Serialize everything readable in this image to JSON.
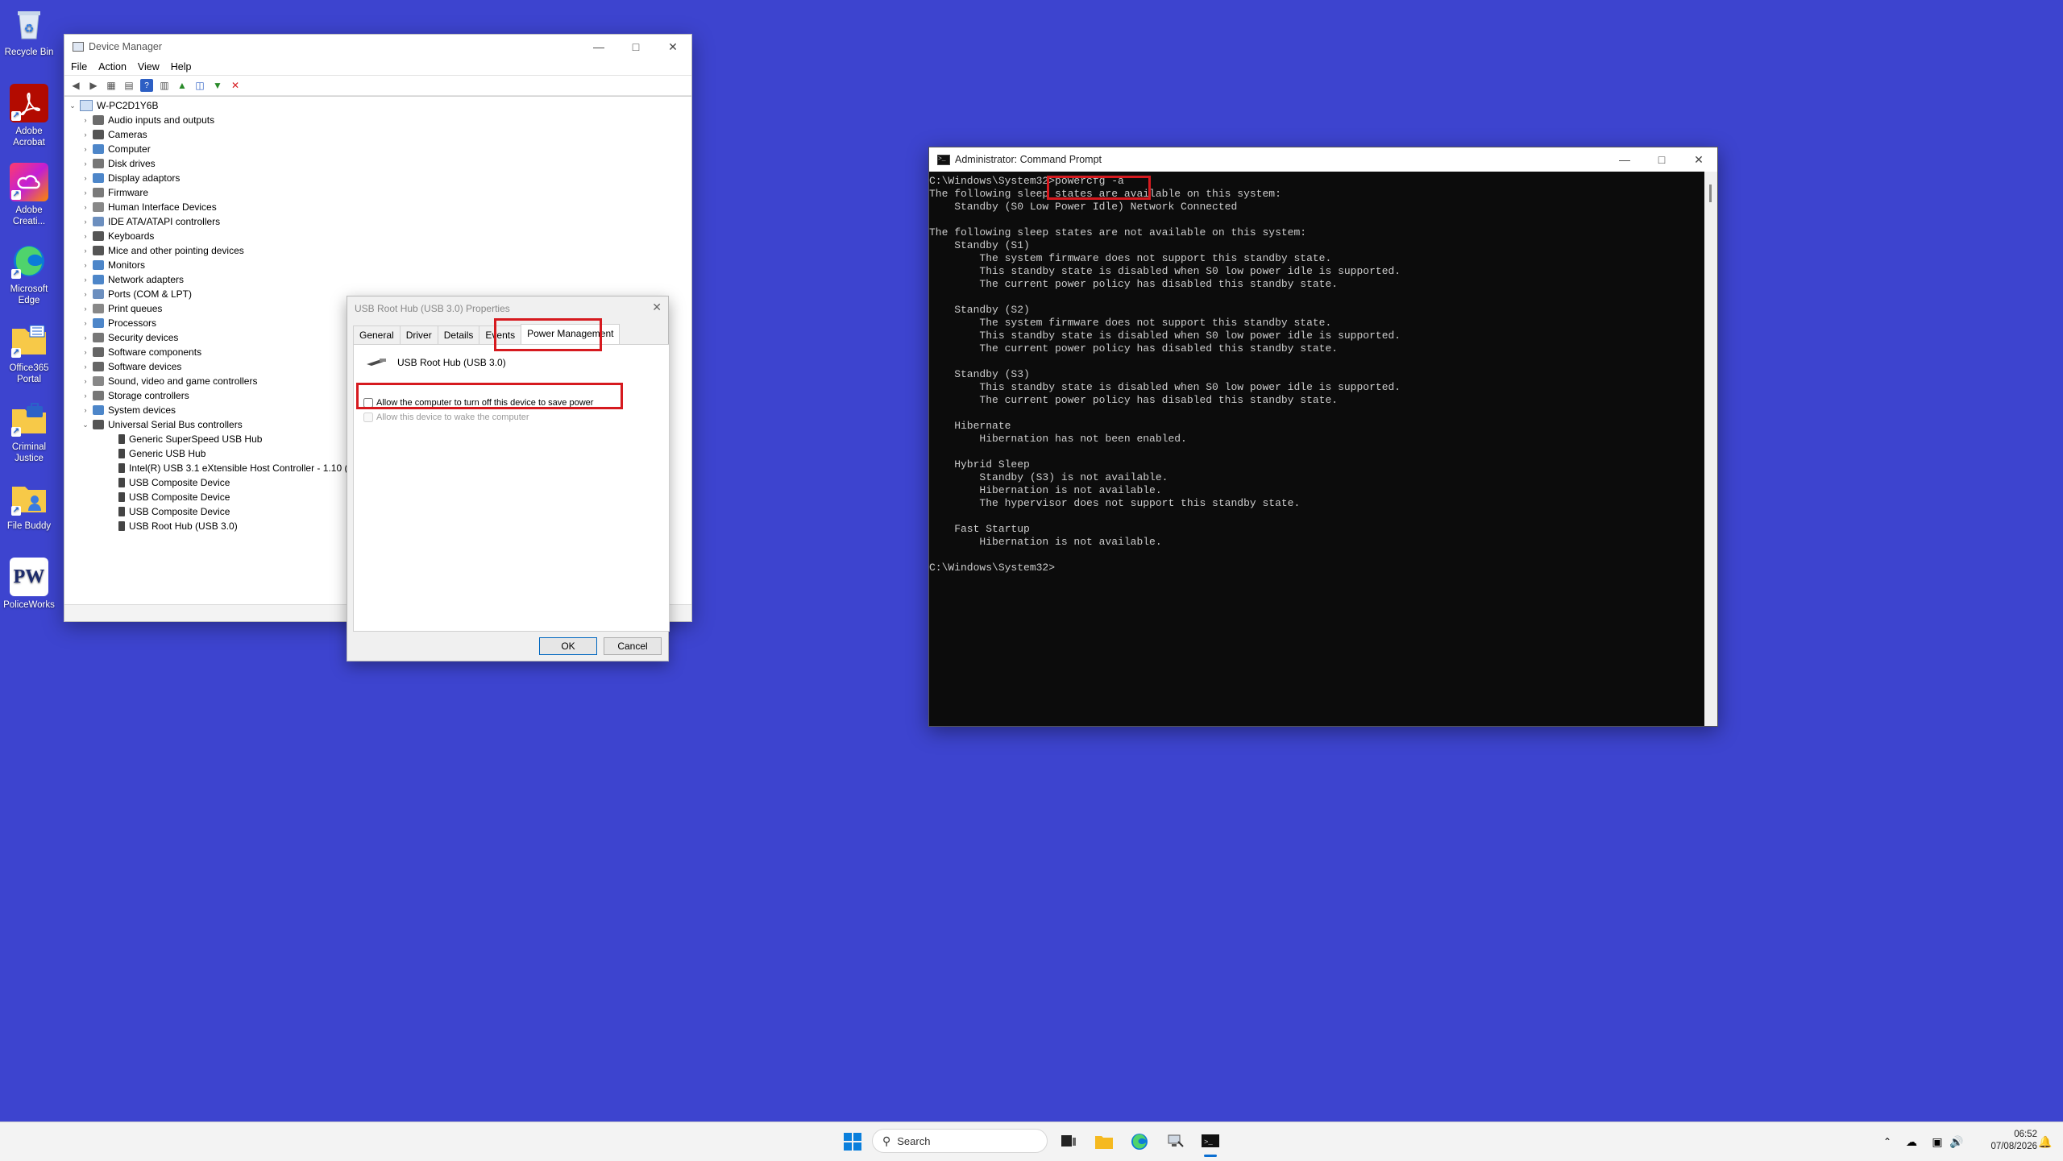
{
  "desktop": {
    "icons": [
      {
        "label_1": "Recycle Bin",
        "label_2": "",
        "icon": "recycle-bin-icon"
      },
      {
        "label_1": "Adobe",
        "label_2": "Acrobat",
        "icon": "adobe-acrobat-icon"
      },
      {
        "label_1": "Adobe",
        "label_2": "Creati...",
        "icon": "adobe-creative-cloud-icon"
      },
      {
        "label_1": "Microsoft",
        "label_2": "Edge",
        "icon": "edge-icon"
      },
      {
        "label_1": "Office365",
        "label_2": "Portal",
        "icon": "folder-icon"
      },
      {
        "label_1": "Criminal",
        "label_2": "Justice",
        "icon": "briefcase-icon"
      },
      {
        "label_1": "File Buddy",
        "label_2": "",
        "icon": "folder-people-icon"
      },
      {
        "label_1": "PoliceWorks",
        "label_2": "",
        "icon": "policeworks-icon"
      }
    ],
    "policeworks_glyph": "PW"
  },
  "device_manager": {
    "title": "Device Manager",
    "menu": [
      "File",
      "Action",
      "View",
      "Help"
    ],
    "root": "W-PC2D1Y6B",
    "categories": [
      "Audio inputs and outputs",
      "Cameras",
      "Computer",
      "Disk drives",
      "Display adaptors",
      "Firmware",
      "Human Interface Devices",
      "IDE ATA/ATAPI controllers",
      "Keyboards",
      "Mice and other pointing devices",
      "Monitors",
      "Network adapters",
      "Ports (COM & LPT)",
      "Print queues",
      "Processors",
      "Security devices",
      "Software components",
      "Software devices",
      "Sound, video and game controllers",
      "Storage controllers",
      "System devices",
      "Universal Serial Bus controllers"
    ],
    "usb_children": [
      "Generic SuperSpeed USB Hub",
      "Generic USB Hub",
      "Intel(R) USB 3.1 eXtensible Host Controller - 1.10 (M",
      "USB Composite Device",
      "USB Composite Device",
      "USB Composite Device",
      "USB Root Hub (USB 3.0)"
    ]
  },
  "properties_dialog": {
    "title": "USB Root Hub (USB 3.0) Properties",
    "tabs": [
      "General",
      "Driver",
      "Details",
      "Events",
      "Power Management"
    ],
    "active_tab": "Power Management",
    "device_name": "USB Root Hub (USB 3.0)",
    "checkbox_power_off": "Allow the computer to turn off this device to save power",
    "checkbox_power_off_checked": false,
    "checkbox_wake": "Allow this device to wake the computer",
    "checkbox_wake_checked": false,
    "checkbox_wake_enabled": false,
    "ok": "OK",
    "cancel": "Cancel"
  },
  "command_prompt": {
    "title": "Administrator: Command Prompt",
    "prompt": "C:\\Windows\\System32>",
    "command": "powercfg -a",
    "output": "The following sleep states are available on this system:\n    Standby (S0 Low Power Idle) Network Connected\n\nThe following sleep states are not available on this system:\n    Standby (S1)\n        The system firmware does not support this standby state.\n        This standby state is disabled when S0 low power idle is supported.\n        The current power policy has disabled this standby state.\n\n    Standby (S2)\n        The system firmware does not support this standby state.\n        This standby state is disabled when S0 low power idle is supported.\n        The current power policy has disabled this standby state.\n\n    Standby (S3)\n        This standby state is disabled when S0 low power idle is supported.\n        The current power policy has disabled this standby state.\n\n    Hibernate\n        Hibernation has not been enabled.\n\n    Hybrid Sleep\n        Standby (S3) is not available.\n        Hibernation is not available.\n        The hypervisor does not support this standby state.\n\n    Fast Startup\n        Hibernation is not available.\n\n",
    "final_prompt": "C:\\Windows\\System32>"
  },
  "taskbar": {
    "search_placeholder": "Search",
    "time": "06:52",
    "date": "07/08/2026"
  },
  "colors": {
    "desktop": "#3d44cf",
    "highlight_box": "#d61a1f",
    "console_bg": "#0c0c0c",
    "console_text": "#cccccc"
  }
}
